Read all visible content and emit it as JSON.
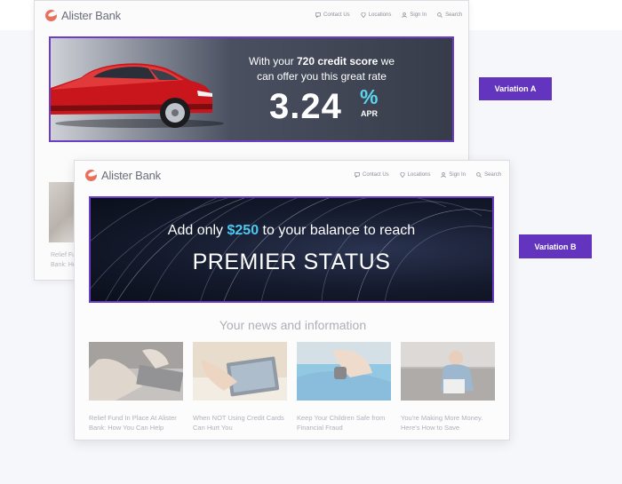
{
  "brand": {
    "name": "Alister Bank",
    "accent": "#e8715e"
  },
  "nav": {
    "contact": "Contact Us",
    "locations": "Locations",
    "sign_in": "Sign In",
    "search": "Search"
  },
  "variation_a": {
    "label": "Variation A",
    "headline_prefix": "With your ",
    "credit_score": "720 credit score",
    "headline_suffix": " we",
    "headline_line2": "can offer you this great rate",
    "rate": "3.24",
    "rate_symbol": "%",
    "rate_unit": "APR",
    "peek_text_line1": "Relief Fu",
    "peek_text_line2": "Bank: Ho"
  },
  "variation_b": {
    "label": "Variation B",
    "headline_prefix": "Add only ",
    "amount": "$250",
    "headline_suffix": " to your balance to reach",
    "status": "PREMIER STATUS",
    "news_title": "Your news and information",
    "articles": [
      {
        "line1": "Relief Fund In Place At Alister",
        "line2": "Bank: How You Can Help"
      },
      {
        "line1": "When NOT Using Credit Cards",
        "line2": "Can Hurt You"
      },
      {
        "line1": "Keep Your Children Safe from",
        "line2": "Financial Fraud"
      },
      {
        "line1": "You're Making More Money.",
        "line2": "Here's How to Save"
      }
    ]
  },
  "colors": {
    "variation_label_bg": "#6334bd",
    "banner_border": "#6c3dc6",
    "highlight_cyan": "#4cc8ee"
  }
}
